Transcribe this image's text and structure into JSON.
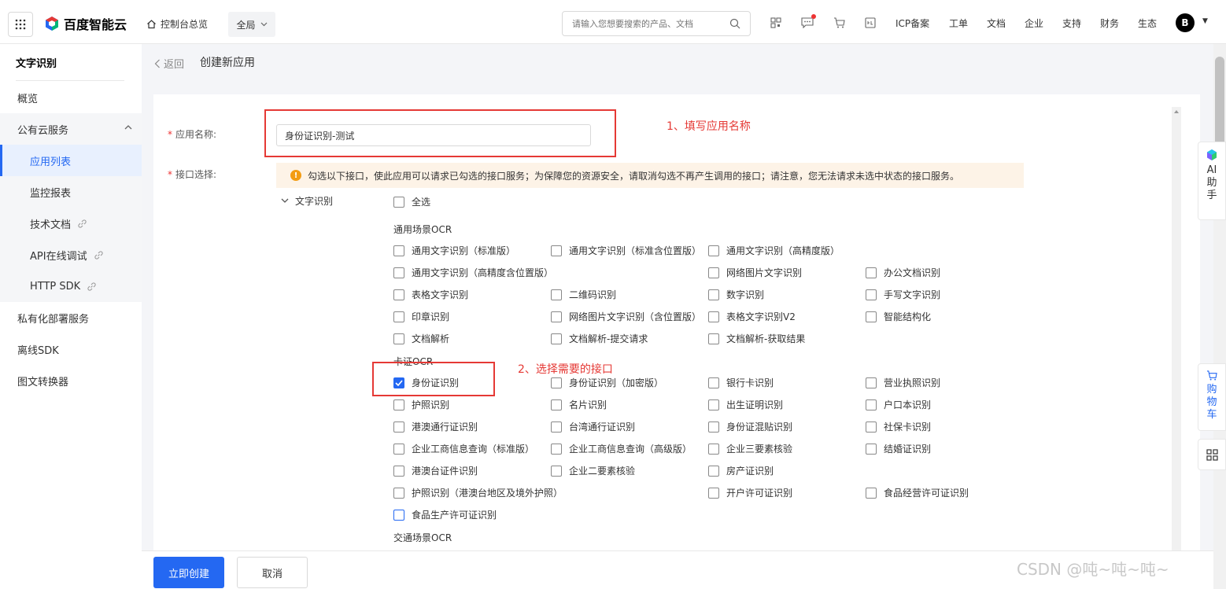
{
  "header": {
    "logo_text": "百度智能云",
    "console_label": "控制台总览",
    "region_label": "全局",
    "search_placeholder": "请输入您想要搜索的产品、文档",
    "nav_items": [
      "ICP备案",
      "工单",
      "文档",
      "企业",
      "支持",
      "财务",
      "生态"
    ],
    "avatar_letter": "B"
  },
  "sidebar": {
    "title": "文字识别",
    "overview": "概览",
    "public_cloud": "公有云服务",
    "sub_items": [
      "应用列表",
      "监控报表",
      "技术文档",
      "API在线调试",
      "HTTP SDK"
    ],
    "private": "私有化部署服务",
    "offline_sdk": "离线SDK",
    "converter": "图文转换器"
  },
  "breadcrumb": {
    "back_label": "返回",
    "page_title": "创建新应用"
  },
  "form": {
    "name_label": "应用名称:",
    "name_value": "身份证识别-测试",
    "api_label": "接口选择:",
    "notice": "勾选以下接口，使此应用可以请求已勾选的接口服务；为保障您的资源安全，请取消勾选不再产生调用的接口；请注意，您无法请求未选中状态的接口服务。",
    "group_name": "文字识别",
    "select_all": "全选",
    "section_general": "通用场景OCR",
    "section_card": "卡证OCR",
    "section_traffic": "交通场景OCR",
    "general": [
      [
        "通用文字识别（标准版）",
        "通用文字识别（标准含位置版）",
        "通用文字识别（高精度版）",
        ""
      ],
      [
        "通用文字识别（高精度含位置版）",
        "",
        "网络图片文字识别",
        "办公文档识别"
      ],
      [
        "表格文字识别",
        "二维码识别",
        "数字识别",
        "手写文字识别"
      ],
      [
        "印章识别",
        "网络图片文字识别（含位置版）",
        "表格文字识别V2",
        "智能结构化"
      ],
      [
        "文档解析",
        "文档解析-提交请求",
        "文档解析-获取结果",
        ""
      ]
    ],
    "card": [
      [
        "身份证识别",
        "身份证识别（加密版）",
        "银行卡识别",
        "营业执照识别"
      ],
      [
        "护照识别",
        "名片识别",
        "出生证明识别",
        "户口本识别"
      ],
      [
        "港澳通行证识别",
        "台湾通行证识别",
        "身份证混贴识别",
        "社保卡识别"
      ],
      [
        "企业工商信息查询（标准版）",
        "企业工商信息查询（高级版）",
        "企业三要素核验",
        "结婚证识别"
      ],
      [
        "港澳台证件识别",
        "企业二要素核验",
        "房产证识别",
        ""
      ],
      [
        "护照识别（港澳台地区及境外护照）",
        "",
        "开户许可证识别",
        "食品经营许可证识别"
      ],
      [
        "食品生产许可证识别",
        "",
        "",
        ""
      ]
    ],
    "checked": "身份证识别"
  },
  "annotations": {
    "step1": "1、填写应用名称",
    "step2": "2、选择需要的接口"
  },
  "footer": {
    "create_label": "立即创建",
    "cancel_label": "取消"
  },
  "float": {
    "ai_label": "AI助手",
    "cart_label": "购物车"
  },
  "watermark": "CSDN @吨~吨~吨~",
  "colors": {
    "accent": "#2468f2",
    "annotation": "#e53935",
    "notice_bg": "#fdf3e7"
  }
}
